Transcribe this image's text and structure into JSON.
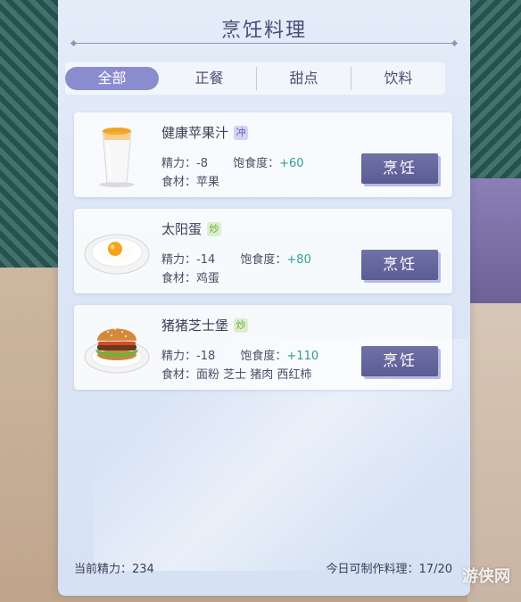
{
  "panel": {
    "title": "烹饪料理"
  },
  "tabs": [
    {
      "label": "全部",
      "active": true
    },
    {
      "label": "正餐",
      "active": false
    },
    {
      "label": "甜点",
      "active": false
    },
    {
      "label": "饮料",
      "active": false
    }
  ],
  "recipes": [
    {
      "name": "健康苹果汁",
      "tag": "冲",
      "stamina_label": "精力：",
      "stamina": "-8",
      "satiety_label": "饱食度：",
      "satiety": "+60",
      "ingredients_label": "食材：",
      "ingredients": "苹果",
      "cook_label": "烹饪",
      "icon": "juice-cup-icon"
    },
    {
      "name": "太阳蛋",
      "tag": "炒",
      "stamina_label": "精力：",
      "stamina": "-14",
      "satiety_label": "饱食度：",
      "satiety": "+80",
      "ingredients_label": "食材：",
      "ingredients": "鸡蛋",
      "cook_label": "烹饪",
      "icon": "fried-egg-icon"
    },
    {
      "name": "猪猪芝士堡",
      "tag": "炒",
      "stamina_label": "精力：",
      "stamina": "-18",
      "satiety_label": "饱食度：",
      "satiety": "+110",
      "ingredients_label": "食材：",
      "ingredients": "面粉 芝士 猪肉 西红柿",
      "cook_label": "烹饪",
      "icon": "burger-icon"
    }
  ],
  "footer": {
    "current_stamina_label": "当前精力：",
    "current_stamina": "234",
    "daily_limit_label": "今日可制作料理：",
    "daily_limit": "17/20"
  },
  "watermark": "游侠网",
  "colors": {
    "accent": "#8a8ccf",
    "button": "#5f619a",
    "satiety": "#2f9e8e",
    "title": "#4a4c74"
  }
}
